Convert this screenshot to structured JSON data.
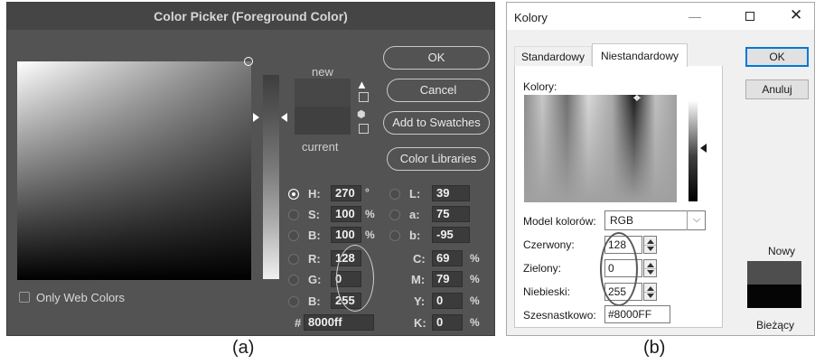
{
  "photoshop": {
    "title": "Color Picker (Foreground Color)",
    "new_label": "new",
    "current_label": "current",
    "buttons": {
      "ok": "OK",
      "cancel": "Cancel",
      "add_to_swatches": "Add to Swatches",
      "color_libraries": "Color Libraries"
    },
    "fields": {
      "h": {
        "label": "H:",
        "value": "270",
        "unit": "°"
      },
      "s": {
        "label": "S:",
        "value": "100",
        "unit": "%"
      },
      "b_hsb": {
        "label": "B:",
        "value": "100",
        "unit": "%"
      },
      "r": {
        "label": "R:",
        "value": "128"
      },
      "g": {
        "label": "G:",
        "value": "0"
      },
      "b_rgb": {
        "label": "B:",
        "value": "255"
      },
      "l": {
        "label": "L:",
        "value": "39"
      },
      "a": {
        "label": "a:",
        "value": "75"
      },
      "b_lab": {
        "label": "b:",
        "value": "-95"
      },
      "c": {
        "label": "C:",
        "value": "69",
        "unit": "%"
      },
      "m": {
        "label": "M:",
        "value": "79",
        "unit": "%"
      },
      "y": {
        "label": "Y:",
        "value": "0",
        "unit": "%"
      },
      "k": {
        "label": "K:",
        "value": "0",
        "unit": "%"
      },
      "hex": {
        "label": "#",
        "value": "8000ff"
      }
    },
    "only_web_colors_label": "Only Web Colors",
    "selected_mode": "H"
  },
  "windows": {
    "title": "Kolory",
    "tabs": [
      "Standardowy",
      "Niestandardowy"
    ],
    "active_tab": "Niestandardowy",
    "colors_label": "Kolory:",
    "model_label": "Model kolorów:",
    "model_value": "RGB",
    "red_label": "Czerwony:",
    "red_value": "128",
    "green_label": "Zielony:",
    "green_value": "0",
    "blue_label": "Niebieski:",
    "blue_value": "255",
    "hex_label": "Szesnastkowo:",
    "hex_value": "#8000FF",
    "ok": "OK",
    "cancel": "Anuluj",
    "new_label": "Nowy",
    "current_label": "Bieżący"
  },
  "captions": {
    "a": "(a)",
    "b": "(b)"
  },
  "icons": [
    "warning-triangle-icon",
    "cube-icon",
    "minimize-icon",
    "maximize-icon",
    "close-icon",
    "chevron-down-icon",
    "spin-up-icon",
    "spin-down-icon"
  ]
}
